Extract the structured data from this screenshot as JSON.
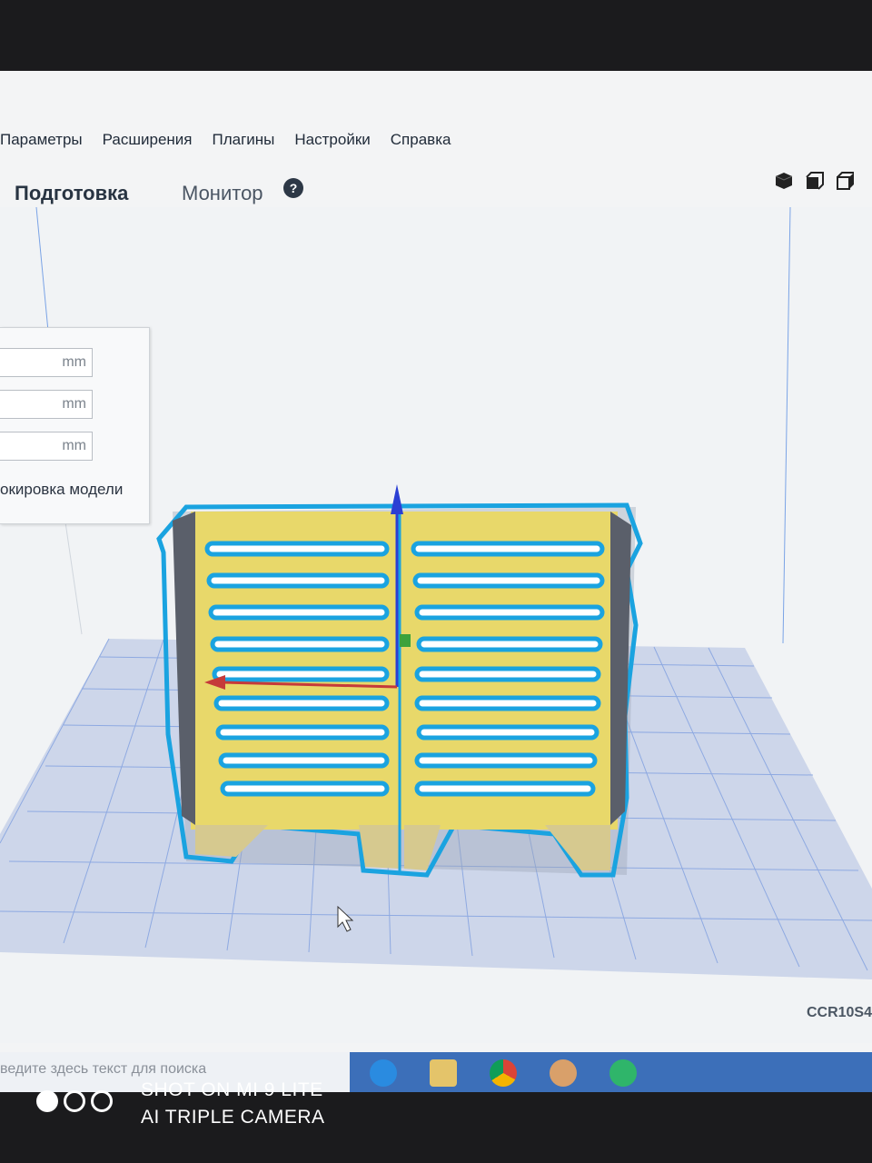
{
  "menubar": {
    "items": [
      "Параметры",
      "Расширения",
      "Плагины",
      "Настройки",
      "Справка"
    ]
  },
  "tabs": {
    "prepare": "Подготовка",
    "monitor": "Монитор"
  },
  "transform_panel": {
    "fields": [
      {
        "unit": "mm"
      },
      {
        "unit": "mm"
      },
      {
        "unit": "mm"
      }
    ],
    "lock_label": "окировка модели"
  },
  "model": {
    "name_label": "CCR10S4"
  },
  "taskbar": {
    "search_placeholder": "ведите здесь текст для поиска",
    "apps": [
      "edge-icon",
      "file-explorer-icon",
      "chrome-icon",
      "paint-icon",
      "cura-icon"
    ]
  },
  "watermark": {
    "line1": "SHOT ON MI 9 LITE",
    "line2": "AI TRIPLE CAMERA"
  },
  "colors": {
    "accent": "#2f7ad6",
    "model_yellow": "#e8d86a",
    "model_outline": "#1aa3e0",
    "grid": "#6a8fd6"
  }
}
